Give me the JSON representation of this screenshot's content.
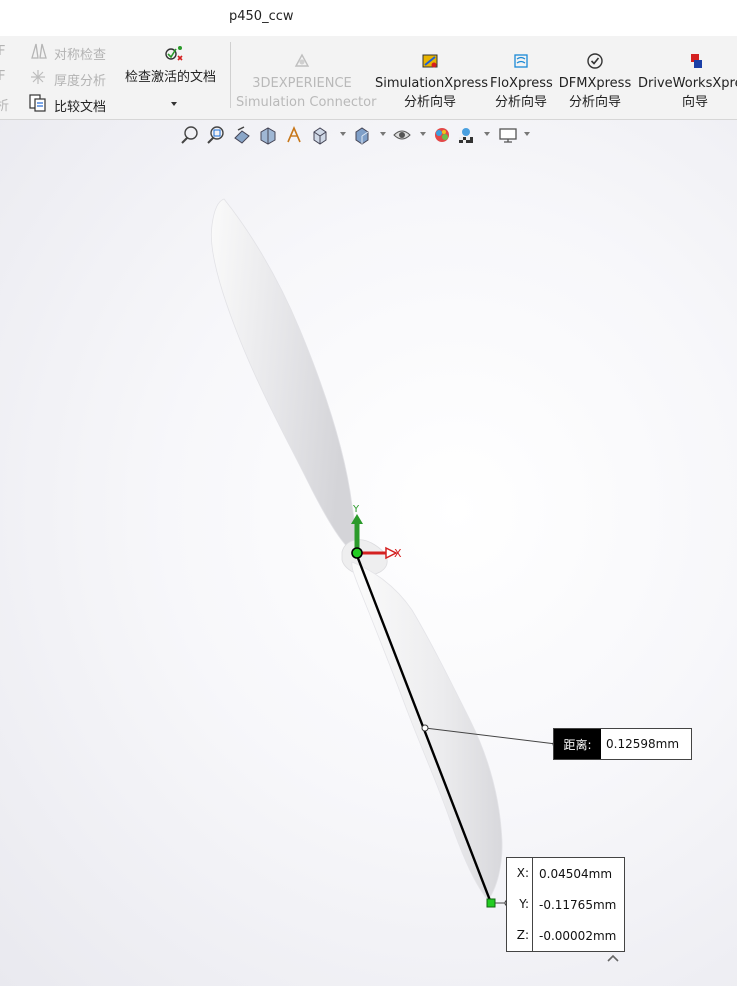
{
  "window": {
    "title": "p450_ccw"
  },
  "ribbon": {
    "left_partial_top": "F",
    "left_partial_mid": "F",
    "left_partial_bottom": "析",
    "symmetry_check": "对称检查",
    "thickness_analysis": "厚度分析",
    "compare_documents": "比较文档",
    "check_active_doc": "检查激活的文档",
    "dexp_line1": "3DEXPERIENCE",
    "dexp_line2": "Simulation Connector",
    "simxpress_line1": "SimulationXpress",
    "simxpress_line2": "分析向导",
    "floxpress_line1": "FloXpress",
    "floxpress_line2": "分析向导",
    "dfmxpress_line1": "DFMXpress",
    "dfmxpress_line2": "分析向导",
    "driveworks_line1": "DriveWorksXpre",
    "driveworks_line2": "向导"
  },
  "triad": {
    "x_label": "X",
    "y_label": "Y"
  },
  "measure": {
    "distance_label": "距离:",
    "distance_value": "0.12598mm",
    "x_key": "X:",
    "x_value": "0.04504mm",
    "y_key": "Y:",
    "y_value": "-0.11765mm",
    "z_key": "Z:",
    "z_value": "-0.00002mm"
  },
  "colors": {
    "axis_x": "#d42020",
    "axis_y": "#2a9a2a",
    "point": "#22cc22",
    "ribbon_bg": "#f3f3f3"
  }
}
